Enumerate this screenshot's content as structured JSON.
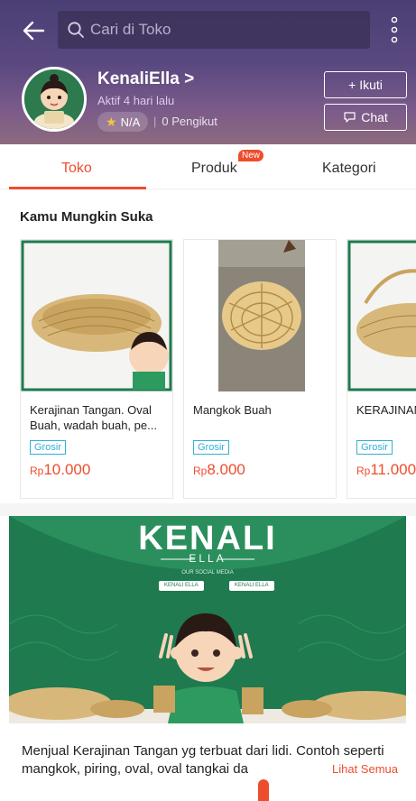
{
  "header": {
    "search_placeholder": "Cari di Toko",
    "shop_name": "KenaliElla >",
    "active_status": "Aktif 4 hari lalu",
    "rating": "N/A",
    "followers": "0 Pengikut",
    "follow_label": "+ Ikuti",
    "chat_label": "Chat",
    "icons": [
      "back-arrow-icon",
      "search-icon",
      "more-icon",
      "star-icon",
      "chat-bubble-icon"
    ]
  },
  "tabs": {
    "items": [
      "Toko",
      "Produk",
      "Kategori"
    ],
    "active": "Toko",
    "new_badge": "New"
  },
  "recommendations": {
    "title": "Kamu Mungkin Suka",
    "products": [
      {
        "name": "Kerajinan Tangan. Oval Buah, wadah buah, pe...",
        "badge": "Grosir",
        "currency": "Rp",
        "price": "10.000"
      },
      {
        "name": "Mangkok Buah",
        "badge": "Grosir",
        "currency": "Rp",
        "price": "8.000"
      },
      {
        "name": "KERAJINAN OVAL TANG",
        "badge": "Grosir",
        "currency": "Rp",
        "price": "11.000"
      }
    ]
  },
  "banner": {
    "title": "KENALI",
    "subtitle": "ELLA",
    "social_caption": "OUR SOCIAL MEDIA",
    "social_tags": [
      "KENALI ELLA",
      "KENALI ELLA"
    ]
  },
  "description": {
    "text": "Menjual Kerajinan Tangan yg terbuat dari lidi. Contoh seperti mangkok, piring, oval, oval tangkai da",
    "see_all": "Lihat Semua"
  },
  "colors": {
    "accent": "#ee4d2d",
    "header": "#4a3f74",
    "wholesale": "#31b0d6",
    "banner_green": "#1f7a4f"
  }
}
